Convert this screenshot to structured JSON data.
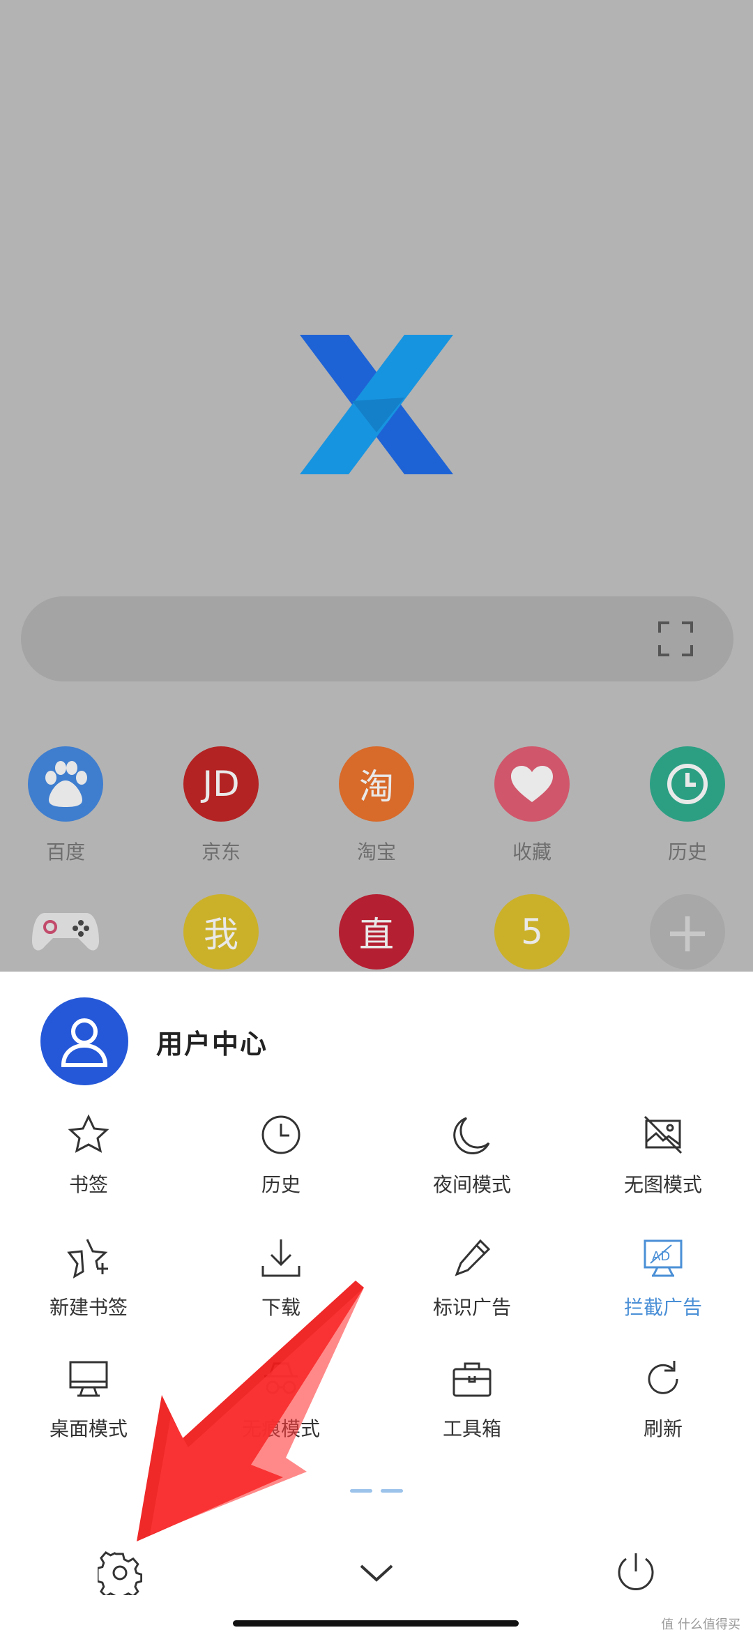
{
  "home": {
    "quick_sites": [
      {
        "label": "百度",
        "icon": "baidu-paw-icon",
        "color": "#3f7ecf"
      },
      {
        "label": "京东",
        "icon": "jd-logo-icon",
        "glyph": "JD",
        "color": "#b42323"
      },
      {
        "label": "淘宝",
        "icon": "taobao-logo-icon",
        "glyph": "淘",
        "color": "#d86a2a"
      },
      {
        "label": "收藏",
        "icon": "heart-icon",
        "color": "#d0576b"
      },
      {
        "label": "历史",
        "icon": "clock-icon",
        "color": "#2c9f83"
      }
    ],
    "quick_sites_row2": [
      {
        "icon": "gamepad-icon",
        "color": "#d8d8d8"
      },
      {
        "glyph": "我",
        "icon": "wo-app-icon",
        "color": "#cbb12a"
      },
      {
        "glyph": "直",
        "icon": "zhi-app-icon",
        "color": "#b51f32"
      },
      {
        "glyph": "5",
        "icon": "five-app-icon",
        "color": "#cbb12a"
      },
      {
        "icon": "add-icon",
        "color": "#a8a8a8"
      }
    ]
  },
  "menu": {
    "user_center": "用户中心",
    "items": [
      {
        "label": "书签",
        "icon": "star-icon"
      },
      {
        "label": "历史",
        "icon": "clock-icon"
      },
      {
        "label": "夜间模式",
        "icon": "moon-icon"
      },
      {
        "label": "无图模式",
        "icon": "no-image-icon"
      },
      {
        "label": "新建书签",
        "icon": "star-add-icon"
      },
      {
        "label": "下载",
        "icon": "download-icon"
      },
      {
        "label": "标识广告",
        "icon": "pen-icon"
      },
      {
        "label": "拦截广告",
        "icon": "ad-block-icon",
        "active": true
      },
      {
        "label": "桌面模式",
        "icon": "monitor-icon"
      },
      {
        "label": "无痕模式",
        "icon": "incognito-icon"
      },
      {
        "label": "工具箱",
        "icon": "toolbox-icon"
      },
      {
        "label": "刷新",
        "icon": "refresh-icon"
      }
    ],
    "bottom": {
      "settings": "settings-icon",
      "collapse": "chevron-down-icon",
      "exit": "power-icon"
    },
    "accent": "#2558d8",
    "active_color": "#4a8fd6"
  },
  "watermark": "值 什么值得买"
}
